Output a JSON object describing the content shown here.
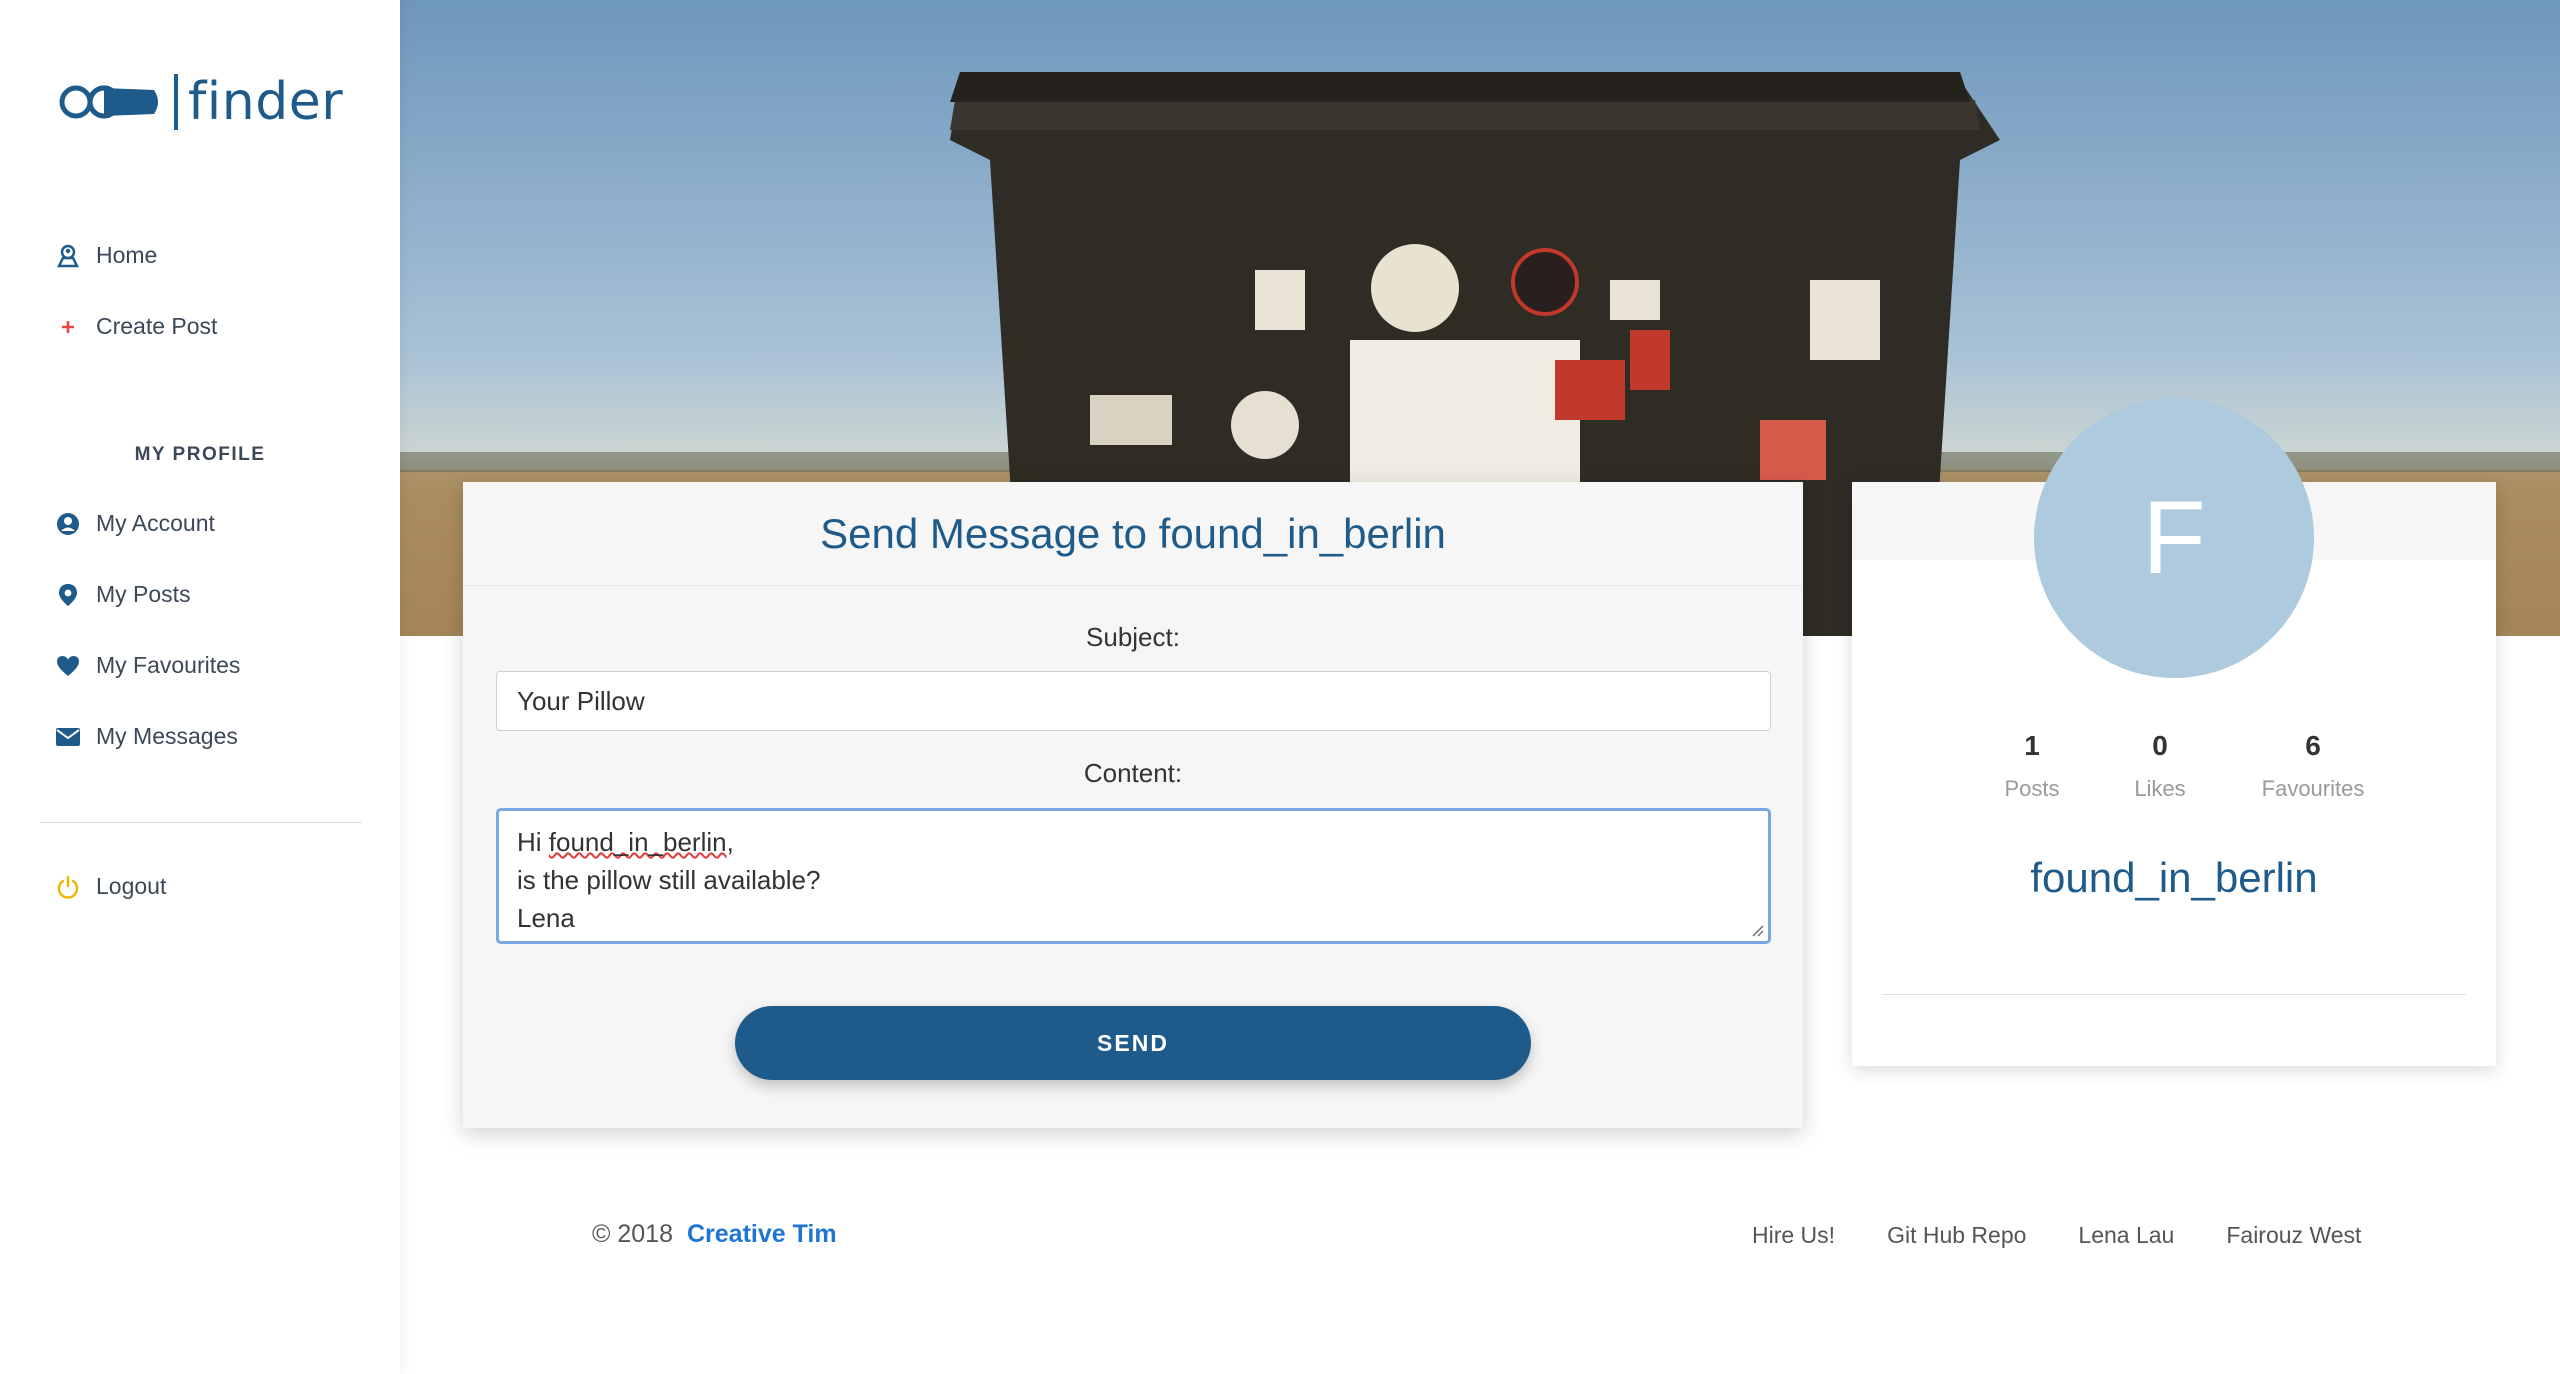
{
  "brand": {
    "logo_text": "finder",
    "accent": "#1f5b8a"
  },
  "sidebar": {
    "nav": [
      {
        "label": "Home",
        "icon": "map-pin-person-icon"
      },
      {
        "label": "Create Post",
        "icon": "plus-icon"
      }
    ],
    "section_title": "MY PROFILE",
    "profile_nav": [
      {
        "label": "My Account",
        "icon": "user-circle-icon"
      },
      {
        "label": "My Posts",
        "icon": "location-pin-icon"
      },
      {
        "label": "My Favourites",
        "icon": "heart-icon"
      },
      {
        "label": "My Messages",
        "icon": "envelope-icon"
      }
    ],
    "logout": {
      "label": "Logout",
      "icon": "power-icon"
    }
  },
  "message_form": {
    "title": "Send Message to found_in_berlin",
    "subject_label": "Subject:",
    "subject_value": "Your Pillow",
    "content_label": "Content:",
    "content_lines": {
      "line1_prefix": "Hi ",
      "line1_word": "found_in_berlin",
      "line1_suffix": ",",
      "line2": "is the pillow still available?",
      "line3": "Lena"
    },
    "send_label": "SEND"
  },
  "profile": {
    "initial": "F",
    "avatar_color": "#aecadf",
    "username": "found_in_berlin",
    "stats": [
      {
        "value": "1",
        "label": "Posts"
      },
      {
        "value": "0",
        "label": "Likes"
      },
      {
        "value": "6",
        "label": "Favourites"
      }
    ]
  },
  "footer": {
    "copyright": "© 2018",
    "brand_link": "Creative Tim",
    "links": [
      "Hire Us!",
      "Git Hub Repo",
      "Lena Lau",
      "Fairouz West"
    ]
  }
}
